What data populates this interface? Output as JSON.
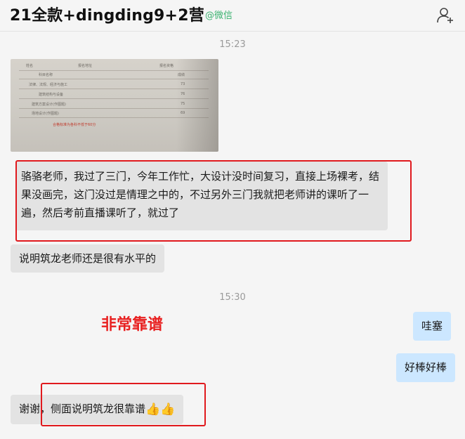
{
  "header": {
    "title": "21全款+dingding9+2营",
    "source_tag": "@微信"
  },
  "messages": {
    "timestamp_1": "15:23",
    "image": {
      "row_labels": [
        "科目名称",
        "法律、法规、经济与施工",
        "建筑结构与设备",
        "建筑方案设计(作图题)",
        "场地设计(作图题)"
      ],
      "scores": [
        "成绩",
        "73",
        "76",
        "75",
        "69"
      ],
      "header_labels": [
        "姓名",
        "报名地址",
        "报名资格"
      ],
      "note": "合格标准为各科不低于60分"
    },
    "msg_1": "骆骆老师，我过了三门，今年工作忙，大设计没时间复习，直接上场裸考，结果没画完，这门没过是情理之中的，不过另外三门我就把老师讲的课听了一遍，然后考前直播课听了，就过了",
    "msg_2": "说明筑龙老师还是很有水平的",
    "timestamp_2": "15:30",
    "msg_3": "哇塞",
    "msg_4": "好棒好棒",
    "msg_5": "谢谢，侧面说明筑龙很靠谱",
    "msg_5_emoji": "👍👍"
  },
  "annotation": {
    "text": "非常靠谱",
    "color": "#e82020"
  },
  "colors": {
    "incoming_bubble": "#e3e3e3",
    "outgoing_bubble": "#cce7ff",
    "highlight": "#e0191d",
    "wechat_green": "#3cb371"
  }
}
